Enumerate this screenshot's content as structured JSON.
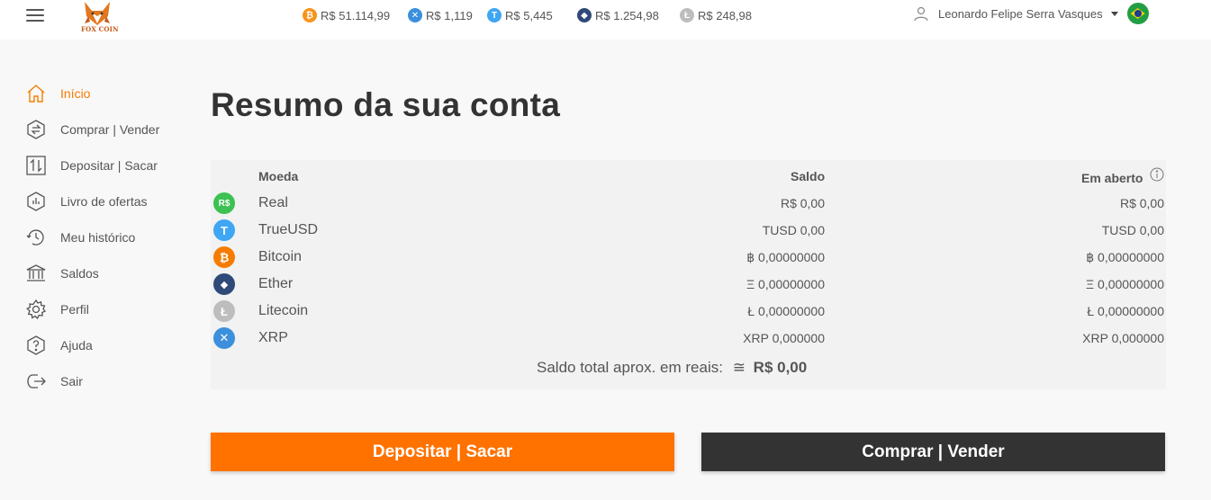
{
  "header": {
    "logo_text": "FOX COIN",
    "tickers": [
      {
        "symbol": "bitcoin",
        "value": "R$ 51.114,99",
        "color": "#f7931a",
        "glyph": "₿"
      },
      {
        "symbol": "xrp",
        "value": "R$ 1,119",
        "color": "#3b8fdc",
        "glyph": "✕"
      },
      {
        "symbol": "trueusd",
        "value": "R$ 5,445",
        "color": "#3ea6f2",
        "glyph": "T"
      },
      {
        "symbol": "ether",
        "value": "R$ 1.254,98",
        "color": "#2f4a78",
        "glyph": "◆"
      },
      {
        "symbol": "litecoin",
        "value": "R$ 248,98",
        "color": "#bdbdbd",
        "glyph": "Ł"
      }
    ],
    "user_name": "Leonardo Felipe Serra Vasques"
  },
  "sidebar": {
    "items": [
      {
        "label": "Início",
        "icon": "home-icon",
        "active": true
      },
      {
        "label": "Comprar | Vender",
        "icon": "exchange-icon"
      },
      {
        "label": "Depositar | Sacar",
        "icon": "deposit-withdraw-icon"
      },
      {
        "label": "Livro de ofertas",
        "icon": "order-book-icon"
      },
      {
        "label": "Meu histórico",
        "icon": "history-icon"
      },
      {
        "label": "Saldos",
        "icon": "bank-icon"
      },
      {
        "label": "Perfil",
        "icon": "gear-icon"
      },
      {
        "label": "Ajuda",
        "icon": "help-icon"
      },
      {
        "label": "Sair",
        "icon": "logout-icon"
      }
    ]
  },
  "main": {
    "title": "Resumo da sua conta",
    "table": {
      "columns": [
        "Moeda",
        "Saldo",
        "Em aberto"
      ],
      "rows": [
        {
          "name": "Real",
          "saldo": "R$ 0,00",
          "aberto": "R$ 0,00",
          "glyph": "R$",
          "color": "#3cc152"
        },
        {
          "name": "TrueUSD",
          "saldo": "TUSD 0,00",
          "aberto": "TUSD 0,00",
          "glyph": "T",
          "color": "#3ea6f2"
        },
        {
          "name": "Bitcoin",
          "saldo": "฿ 0,00000000",
          "aberto": "฿ 0,00000000",
          "glyph": "₿",
          "color": "#f57c00"
        },
        {
          "name": "Ether",
          "saldo": "Ξ 0,00000000",
          "aberto": "Ξ 0,00000000",
          "glyph": "◆",
          "color": "#2f4a78"
        },
        {
          "name": "Litecoin",
          "saldo": "Ł 0,00000000",
          "aberto": "Ł 0,00000000",
          "glyph": "Ł",
          "color": "#bdbdbd"
        },
        {
          "name": "XRP",
          "saldo": "XRP 0,000000",
          "aberto": "XRP 0,000000",
          "glyph": "✕",
          "color": "#3b8fdc"
        }
      ]
    },
    "total_label": "Saldo total aprox. em reais:",
    "total_symbol": "≅",
    "total_value": "R$ 0,00",
    "buttons": {
      "deposit": "Depositar | Sacar",
      "trade": "Comprar | Vender"
    }
  },
  "colors": {
    "accent": "#ff7200",
    "dark_button": "#333333"
  }
}
